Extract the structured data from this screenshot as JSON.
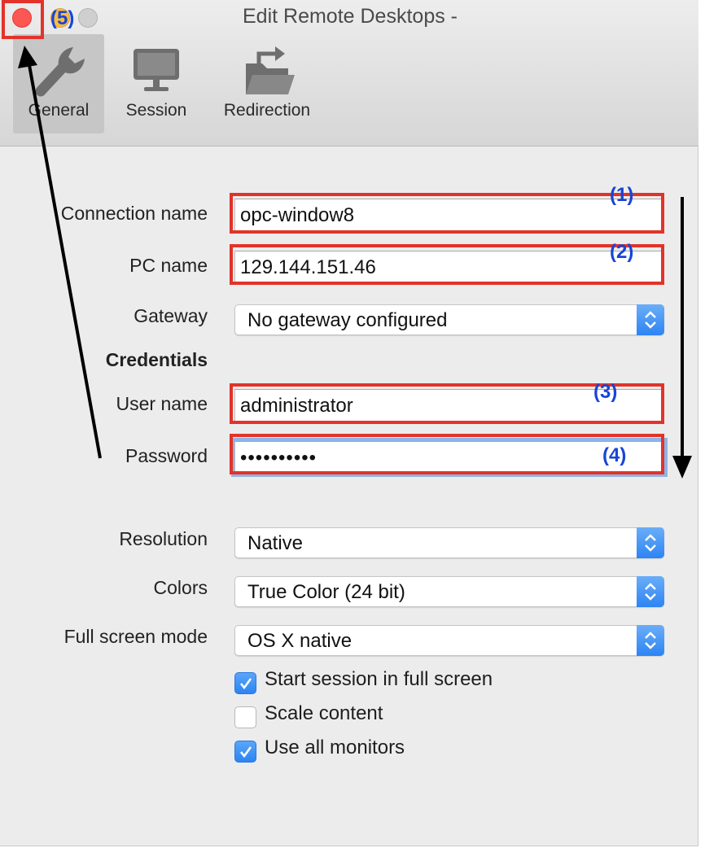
{
  "window": {
    "title": "Edit Remote Desktops -"
  },
  "toolbar": {
    "items": [
      {
        "label": "General",
        "icon": "wrench-icon",
        "selected": true
      },
      {
        "label": "Session",
        "icon": "monitor-icon",
        "selected": false
      },
      {
        "label": "Redirection",
        "icon": "folder-redirect-icon",
        "selected": false
      }
    ]
  },
  "form": {
    "connection_name": {
      "label": "Connection name",
      "value": "opc-window8"
    },
    "pc_name": {
      "label": "PC name",
      "value": "129.144.151.46"
    },
    "gateway": {
      "label": "Gateway",
      "value": "No gateway configured"
    },
    "credentials_heading": "Credentials",
    "user_name": {
      "label": "User name",
      "value": "administrator"
    },
    "password": {
      "label": "Password",
      "value": "••••••••••"
    },
    "resolution": {
      "label": "Resolution",
      "value": "Native"
    },
    "colors": {
      "label": "Colors",
      "value": "True Color (24 bit)"
    },
    "full_screen_mode": {
      "label": "Full screen mode",
      "value": "OS X native"
    },
    "checkboxes": [
      {
        "label": "Start session in full screen",
        "checked": true
      },
      {
        "label": "Scale content",
        "checked": false
      },
      {
        "label": "Use all monitors",
        "checked": true
      }
    ]
  },
  "annotations": {
    "n1": "(1)",
    "n2": "(2)",
    "n3": "(3)",
    "n4": "(4)",
    "n5": "(5)",
    "box_color": "#e2332a",
    "number_color": "#1745d6",
    "arrow_color": "#000000"
  },
  "colors": {
    "accent": "#2d84f3",
    "window_bg": "#ececec",
    "close": "#fc5753",
    "minimize": "#fdbc40"
  }
}
